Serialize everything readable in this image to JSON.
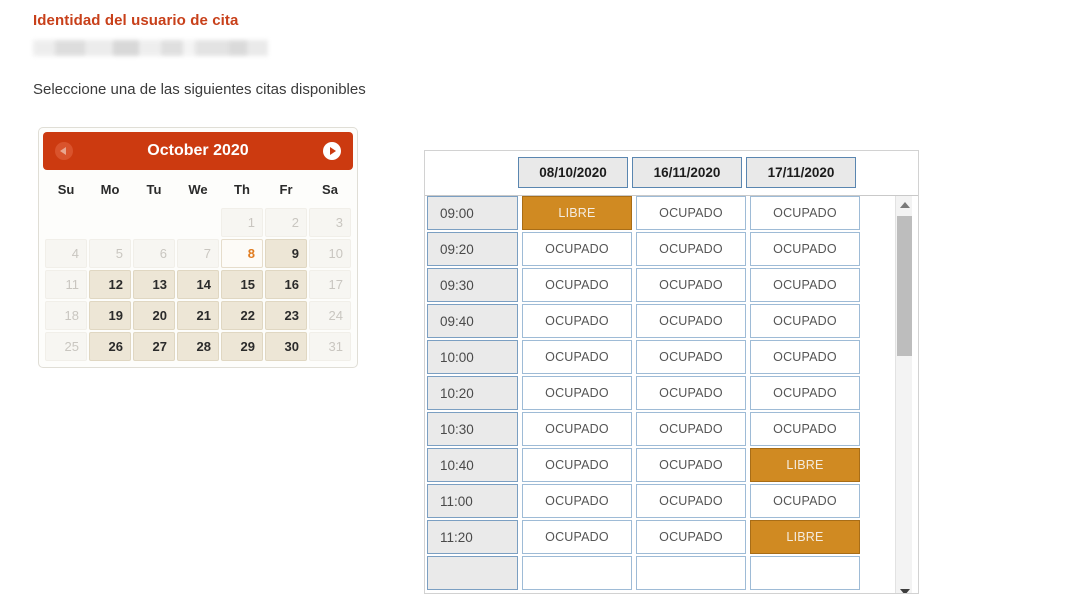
{
  "page": {
    "title": "Identidad del usuario de cita",
    "identity_value_redacted": "",
    "instruction": "Seleccione una de las siguientes citas disponibles"
  },
  "colors": {
    "title": "#c8401a",
    "calendar_header": "#cc3a10",
    "free_slot": "#d08a22",
    "available_day": "#ede6d6",
    "today_text": "#e07b1f",
    "header_cell_border": "#5a86b0"
  },
  "calendar": {
    "month_label": "October 2020",
    "prev_icon": "chevron-left-circle-icon",
    "next_icon": "chevron-right-circle-icon",
    "weekdays": [
      "Su",
      "Mo",
      "Tu",
      "We",
      "Th",
      "Fr",
      "Sa"
    ],
    "weeks": [
      [
        {
          "day": "",
          "state": "empty"
        },
        {
          "day": "",
          "state": "empty"
        },
        {
          "day": "",
          "state": "empty"
        },
        {
          "day": "",
          "state": "empty"
        },
        {
          "day": "1",
          "state": "disabled"
        },
        {
          "day": "2",
          "state": "disabled"
        },
        {
          "day": "3",
          "state": "disabled"
        }
      ],
      [
        {
          "day": "4",
          "state": "disabled"
        },
        {
          "day": "5",
          "state": "disabled"
        },
        {
          "day": "6",
          "state": "disabled"
        },
        {
          "day": "7",
          "state": "disabled"
        },
        {
          "day": "8",
          "state": "today"
        },
        {
          "day": "9",
          "state": "available"
        },
        {
          "day": "10",
          "state": "disabled"
        }
      ],
      [
        {
          "day": "11",
          "state": "disabled"
        },
        {
          "day": "12",
          "state": "available"
        },
        {
          "day": "13",
          "state": "available"
        },
        {
          "day": "14",
          "state": "available"
        },
        {
          "day": "15",
          "state": "available"
        },
        {
          "day": "16",
          "state": "available"
        },
        {
          "day": "17",
          "state": "disabled"
        }
      ],
      [
        {
          "day": "18",
          "state": "disabled"
        },
        {
          "day": "19",
          "state": "available"
        },
        {
          "day": "20",
          "state": "available"
        },
        {
          "day": "21",
          "state": "available"
        },
        {
          "day": "22",
          "state": "available"
        },
        {
          "day": "23",
          "state": "available"
        },
        {
          "day": "24",
          "state": "disabled"
        }
      ],
      [
        {
          "day": "25",
          "state": "disabled"
        },
        {
          "day": "26",
          "state": "available"
        },
        {
          "day": "27",
          "state": "available"
        },
        {
          "day": "28",
          "state": "available"
        },
        {
          "day": "29",
          "state": "available"
        },
        {
          "day": "30",
          "state": "available"
        },
        {
          "day": "31",
          "state": "disabled"
        }
      ]
    ]
  },
  "slots_table": {
    "date_columns": [
      "08/10/2020",
      "16/11/2020",
      "17/11/2020"
    ],
    "status_free": "LIBRE",
    "status_busy": "OCUPADO",
    "rows": [
      {
        "time": "09:00",
        "cells": [
          "LIBRE",
          "OCUPADO",
          "OCUPADO"
        ]
      },
      {
        "time": "09:20",
        "cells": [
          "OCUPADO",
          "OCUPADO",
          "OCUPADO"
        ]
      },
      {
        "time": "09:30",
        "cells": [
          "OCUPADO",
          "OCUPADO",
          "OCUPADO"
        ]
      },
      {
        "time": "09:40",
        "cells": [
          "OCUPADO",
          "OCUPADO",
          "OCUPADO"
        ]
      },
      {
        "time": "10:00",
        "cells": [
          "OCUPADO",
          "OCUPADO",
          "OCUPADO"
        ]
      },
      {
        "time": "10:20",
        "cells": [
          "OCUPADO",
          "OCUPADO",
          "OCUPADO"
        ]
      },
      {
        "time": "10:30",
        "cells": [
          "OCUPADO",
          "OCUPADO",
          "OCUPADO"
        ]
      },
      {
        "time": "10:40",
        "cells": [
          "OCUPADO",
          "OCUPADO",
          "LIBRE"
        ]
      },
      {
        "time": "11:00",
        "cells": [
          "OCUPADO",
          "OCUPADO",
          "OCUPADO"
        ]
      },
      {
        "time": "11:20",
        "cells": [
          "OCUPADO",
          "OCUPADO",
          "LIBRE"
        ]
      },
      {
        "time": "",
        "cells": [
          "",
          "",
          ""
        ]
      }
    ],
    "scrollbar": {
      "up_icon": "scroll-up-arrow-icon",
      "down_icon": "scroll-down-arrow-icon"
    }
  }
}
